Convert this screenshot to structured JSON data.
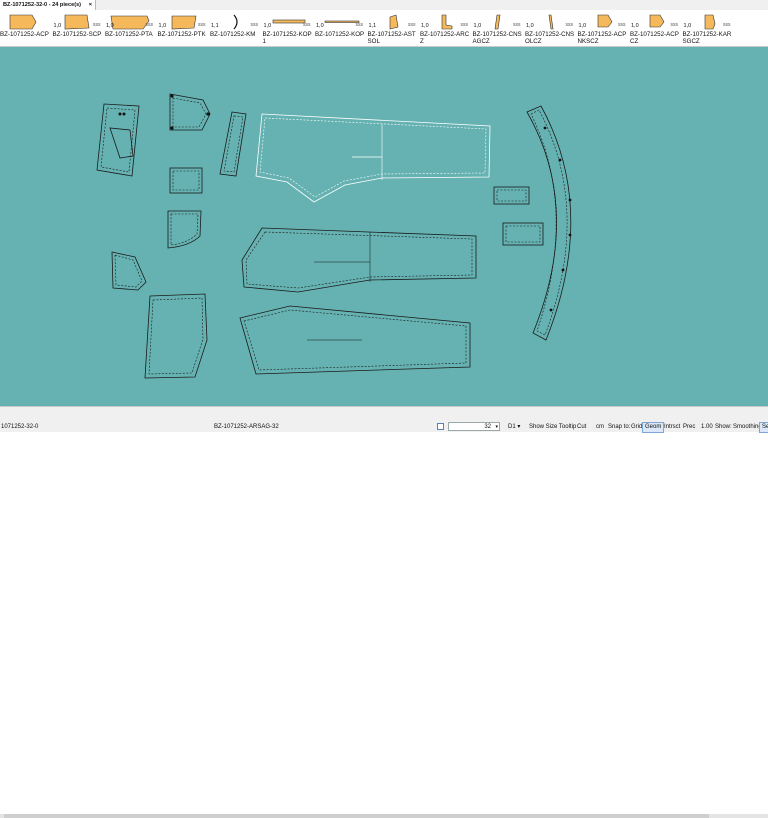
{
  "tab": {
    "title": "BZ-1071252-32-0 - 24 piece(s)",
    "close": "×"
  },
  "pieces": [
    {
      "name": "BZ-1071252-ACP",
      "qty": "",
      "ind": ""
    },
    {
      "name": "BZ-1071252-SCP",
      "qty": "1,0",
      "ind": "sss"
    },
    {
      "name": "BZ-1071252-PTA",
      "qty": "1,0",
      "ind": "sss"
    },
    {
      "name": "BZ-1071252-PTK",
      "qty": "1,0",
      "ind": "sss"
    },
    {
      "name": "BZ-1071252-KM",
      "qty": "1,1",
      "ind": "sss"
    },
    {
      "name": "BZ-1071252-KOP 1",
      "qty": "1,0",
      "ind": "sss"
    },
    {
      "name": "BZ-1071252-KOP",
      "qty": "1,0",
      "ind": "sss"
    },
    {
      "name": "BZ-1071252-AST SOL",
      "qty": "1,1",
      "ind": "sss"
    },
    {
      "name": "BZ-1071252-ARC Z",
      "qty": "1,0",
      "ind": "sss"
    },
    {
      "name": "BZ-1071252-CNS AGCZ",
      "qty": "1,0",
      "ind": "sss"
    },
    {
      "name": "BZ-1071252-CNS OLCZ",
      "qty": "1,0",
      "ind": "sss"
    },
    {
      "name": "BZ-1071252-ACP NKSCZ",
      "qty": "1,0",
      "ind": "sss"
    },
    {
      "name": "BZ-1071252-ACP CZ",
      "qty": "1,0",
      "ind": "sss"
    },
    {
      "name": "BZ-1071252-KAR SGCZ",
      "qty": "1,0",
      "ind": "sss"
    }
  ],
  "colors": {
    "canvas": "#66b2b2",
    "thumb_fill": "#f5b95c",
    "selected_outline": "#ffffff"
  },
  "status": {
    "left": "1071252-32-0",
    "center": "BZ-1071252-ARSAG-32",
    "zoom": "32",
    "size": "D1",
    "show_size_tooltip": "Show Size Tooltip",
    "cut": "Cut",
    "cm": "cm",
    "snap_to": "Snap to:",
    "grid": "Grid",
    "geom": "Geom",
    "intrsct": "Intrsct",
    "prec": "Prec",
    "prec_value": "1.00",
    "show": "Show:",
    "smoothing": "Smoothing",
    "se": "Se"
  }
}
